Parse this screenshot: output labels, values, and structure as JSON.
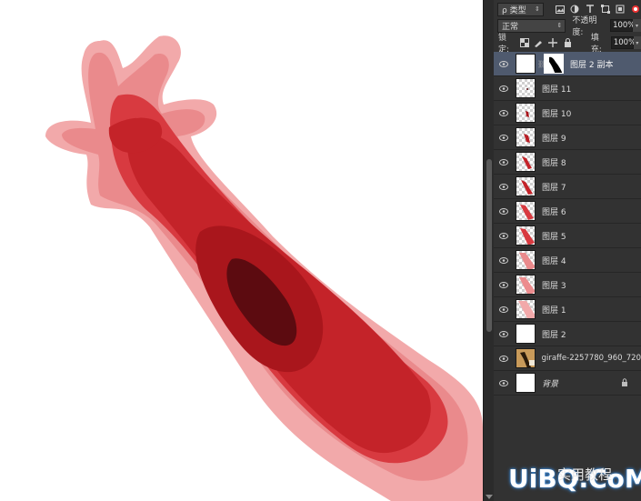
{
  "toolbar_top": {
    "filter_type_label": "ρ 类型",
    "icons": [
      "image-filter-icon",
      "adjustment-filter-icon",
      "text-filter-icon",
      "shape-filter-icon",
      "smart-object-filter-icon",
      "toggle-filter-icon"
    ]
  },
  "blend": {
    "mode": "正常",
    "opacity_label": "不透明度:",
    "opacity_value": "100%"
  },
  "lock": {
    "label": "锁定:",
    "fill_label": "填充:",
    "fill_value": "100%"
  },
  "layers": [
    {
      "name": "图层 2 副本",
      "thumb": "white",
      "mask": true,
      "selected": true
    },
    {
      "name": "图层 11",
      "thumb": "checker-tiny",
      "selected": false
    },
    {
      "name": "图层 10",
      "thumb": "checker-small",
      "selected": false
    },
    {
      "name": "图层 9",
      "thumb": "checker-small",
      "selected": false
    },
    {
      "name": "图层 8",
      "thumb": "checker-red",
      "selected": false
    },
    {
      "name": "图层 7",
      "thumb": "checker-red",
      "selected": false
    },
    {
      "name": "图层 6",
      "thumb": "checker-red",
      "selected": false
    },
    {
      "name": "图层 5",
      "thumb": "checker-red",
      "selected": false
    },
    {
      "name": "图层 4",
      "thumb": "checker-pink",
      "selected": false
    },
    {
      "name": "图层 3",
      "thumb": "checker-pink",
      "selected": false
    },
    {
      "name": "图层 1",
      "thumb": "checker-pink",
      "selected": false
    },
    {
      "name": "图层 2",
      "thumb": "white",
      "selected": false
    },
    {
      "name": "giraffe-2257780_960_720",
      "thumb": "photo",
      "selected": false
    },
    {
      "name": "背景",
      "thumb": "white",
      "locked": true,
      "italic": true,
      "selected": false
    }
  ],
  "watermark": {
    "text": "UiBQ.CoM",
    "small_text": "实用教程"
  },
  "colors": {
    "panel_bg": "#323232",
    "selected_row": "#4f5a6e",
    "red_dark": "#b81e25",
    "red_mid": "#d6333a",
    "pink": "#ec8c8e",
    "maroon": "#5a0a0e"
  }
}
